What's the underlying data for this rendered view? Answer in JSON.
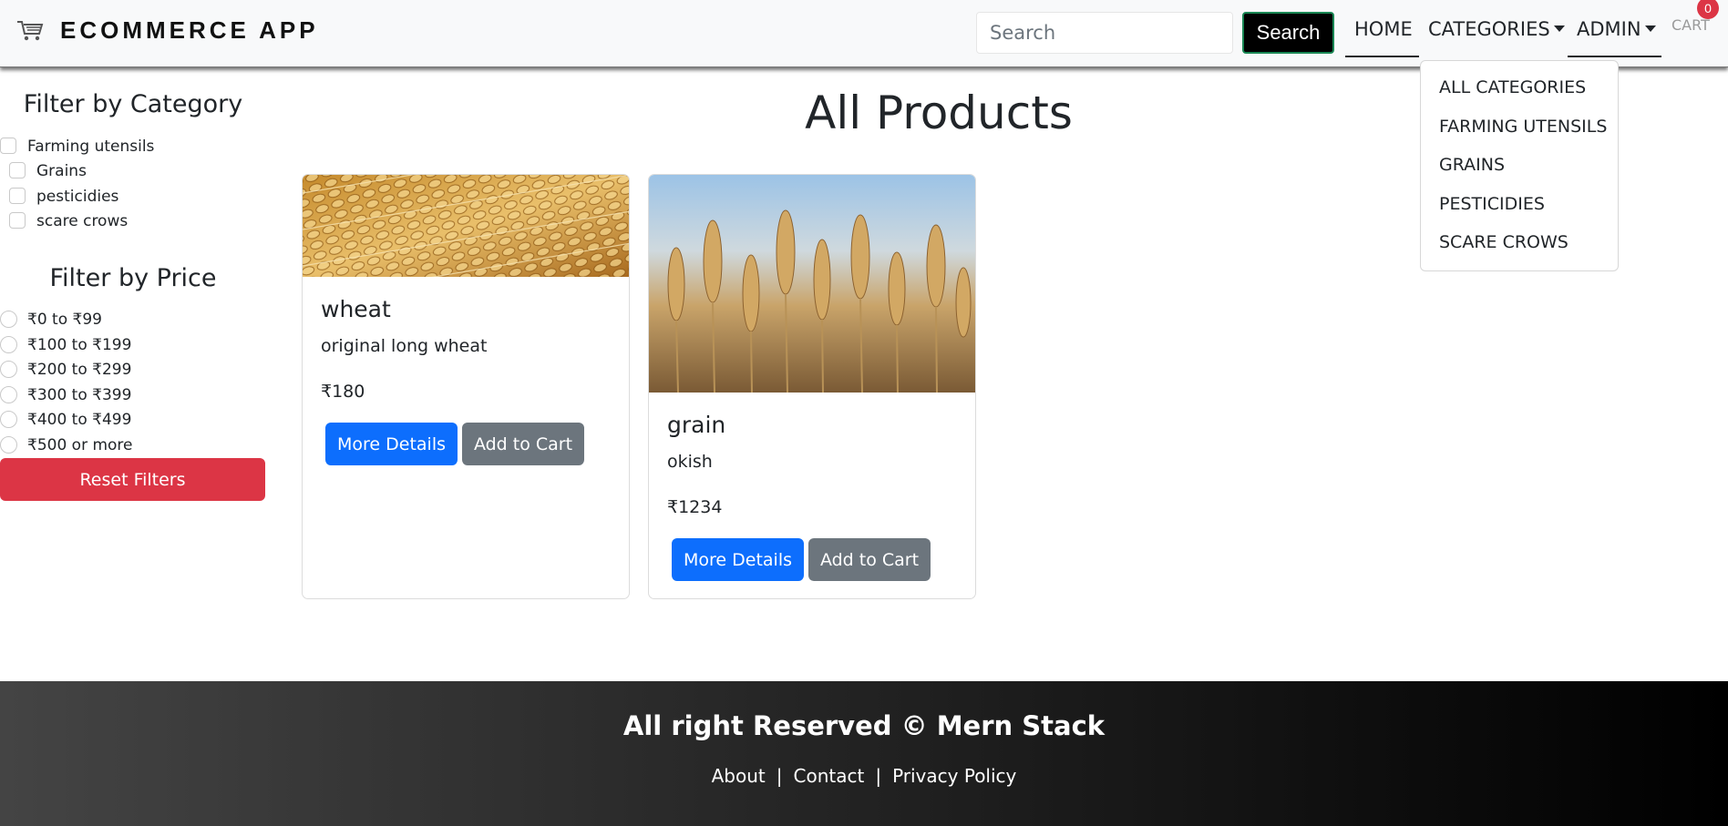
{
  "navbar": {
    "brand": "ECOMMERCE APP",
    "brand_icon": "shopping-cart-icon",
    "search_placeholder": "Search",
    "search_button": "Search",
    "home": "HOME",
    "categories": "CATEGORIES",
    "admin": "ADMIN",
    "cart": "CART",
    "cart_count": "0"
  },
  "dropdown": {
    "items": [
      "ALL CATEGORIES",
      "FARMING UTENSILS",
      "GRAINS",
      "PESTICIDIES",
      "SCARE CROWS"
    ]
  },
  "sidebar": {
    "category_heading": "Filter by Category",
    "categories": [
      "Farming utensils",
      "Grains",
      "pesticidies",
      "scare crows"
    ],
    "price_heading": "Filter by Price",
    "prices": [
      "₹0 to ₹99",
      "₹100 to ₹199",
      "₹200 to ₹299",
      "₹300 to ₹399",
      "₹400 to ₹499",
      "₹500 or more"
    ],
    "reset_button": "Reset Filters"
  },
  "main": {
    "title": "All Products",
    "products": [
      {
        "name": "wheat",
        "description": "original long wheat",
        "price": "₹180",
        "details_button": "More Details",
        "cart_button": "Add to Cart"
      },
      {
        "name": "grain",
        "description": "okish",
        "price": "₹1234",
        "details_button": "More Details",
        "cart_button": "Add to Cart"
      }
    ]
  },
  "footer": {
    "text": "All right Reserved © Mern Stack",
    "links": [
      "About",
      "Contact",
      "Privacy Policy"
    ],
    "separator": "|"
  },
  "colors": {
    "primary": "#0d6efd",
    "secondary": "#6c757d",
    "danger": "#dc3545",
    "navbar_bg": "#f8f9fa"
  }
}
